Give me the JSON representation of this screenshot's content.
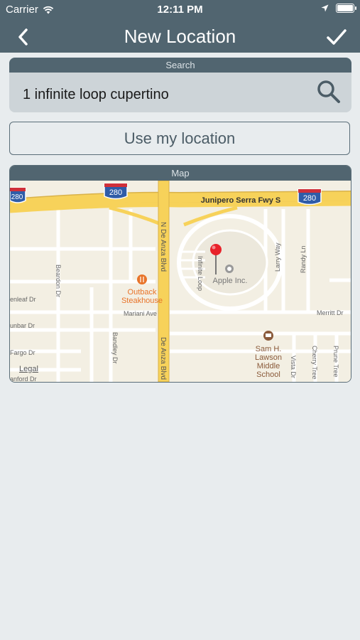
{
  "status_bar": {
    "carrier": "Carrier",
    "time": "12:11 PM"
  },
  "nav": {
    "title": "New Location",
    "back_icon": "chevron-left",
    "done_icon": "checkmark"
  },
  "search": {
    "header": "Search",
    "value": "1 infinite loop cupertino",
    "icon": "magnifier"
  },
  "use_location_label": "Use my location",
  "map": {
    "header": "Map",
    "legal": "Legal",
    "labels": {
      "freeway": "Junipero Serra Fwy S",
      "shield1": "280",
      "shield2": "280",
      "shield3": "280",
      "n_de_anza": "N De Anza Blvd",
      "de_anza": "De Anza Blvd",
      "infinite_loop": "Infinite Loop",
      "apple": "Apple Inc.",
      "beardon": "Beardon Dr",
      "greenleaf": "enleaf Dr",
      "mariani": "Mariani Ave",
      "outback1": "Outback",
      "outback2": "Steakhouse",
      "bandley": "Bandley Dr",
      "dunbar": "unbar Dr",
      "fargo": "Fargo Dr",
      "stanford": "anford Dr",
      "larry": "Larry Way",
      "randy": "Randy Ln",
      "merritt": "Merritt Dr",
      "school1": "Sam H.",
      "school2": "Lawson",
      "school3": "Middle",
      "school4": "School",
      "vista": "Vista Dr",
      "cherry": "Cherry Tree",
      "prune": "Prune Tree"
    }
  },
  "colors": {
    "bar": "#516570",
    "background": "#e8ecee",
    "freeway": "#f7d25a",
    "pin": "#e8222a",
    "poi_orange": "#e8742a",
    "poi_brown": "#8a5a3a"
  }
}
